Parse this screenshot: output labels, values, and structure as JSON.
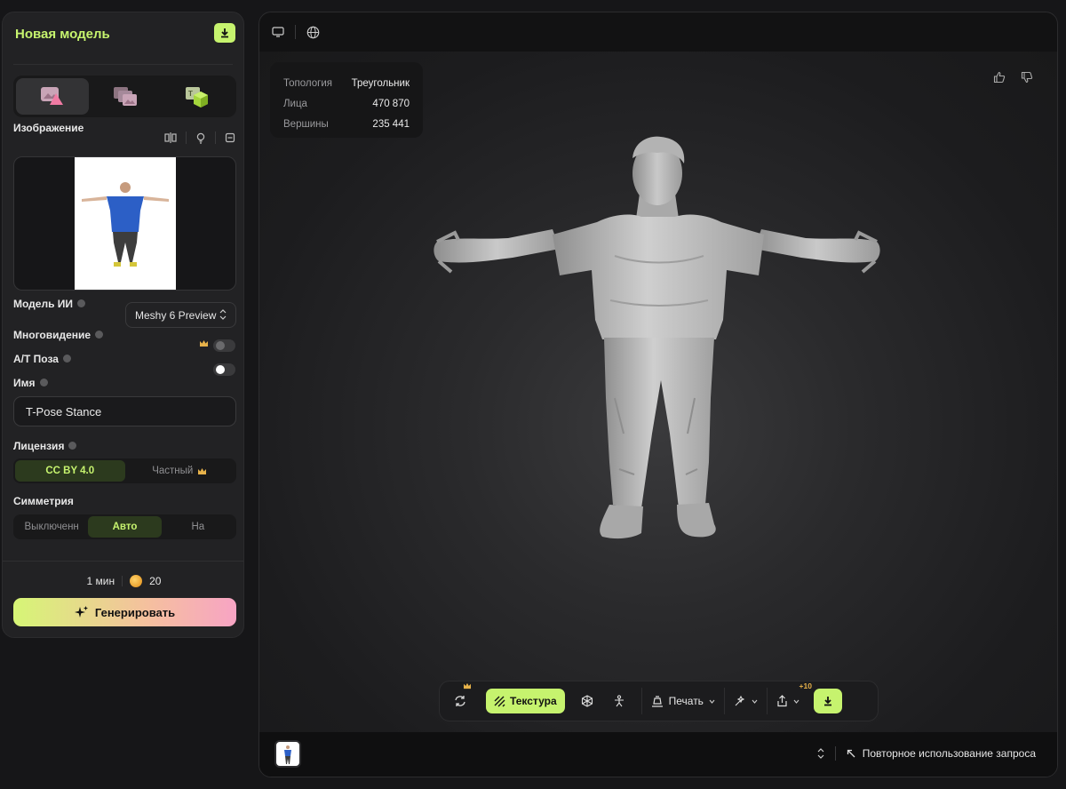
{
  "panel": {
    "title": "Новая модель",
    "image_label": "Изображение",
    "model_label": "Модель ИИ",
    "model_value": "Meshy 6 Preview",
    "multiview_label": "Многовидение",
    "multiview_enabled": false,
    "atpose_label": "A/T Поза",
    "atpose_enabled": false,
    "name_label": "Имя",
    "name_value": "T-Pose Stance",
    "license_label": "Лицензия",
    "license_options": [
      "CC BY 4.0",
      "Частный"
    ],
    "license_selected": "CC BY 4.0",
    "symmetry_label": "Симметрия",
    "symmetry_options": [
      "Выключенн",
      "Авто",
      "На"
    ],
    "symmetry_selected": "Авто",
    "time": "1 мин",
    "credits": "20",
    "generate_label": "Генерировать"
  },
  "stats": [
    {
      "key": "Топология",
      "value": "Треугольник"
    },
    {
      "key": "Лица",
      "value": "470 870"
    },
    {
      "key": "Вершины",
      "value": "235 441"
    }
  ],
  "toolbar": {
    "texture_label": "Текстура",
    "print_label": "Печать",
    "share_badge": "+10"
  },
  "bottom": {
    "reuse_label": "Повторное использование запроса"
  },
  "colors": {
    "accent": "#c6f36e",
    "panel": "#222224",
    "premium": "#e7b24a"
  },
  "icons": [
    "upload-icon",
    "image-to-3d-icon",
    "multi-image-icon",
    "text-to-3d-icon",
    "monitor-icon",
    "globe-icon",
    "thumbs-up-icon",
    "thumbs-down-icon",
    "refresh-icon",
    "crown-icon",
    "texture-icon",
    "mesh-icon",
    "rig-icon",
    "print-icon",
    "magic-icon",
    "share-icon",
    "download-icon",
    "sparkle-icon",
    "coin-icon",
    "reuse-icon"
  ]
}
